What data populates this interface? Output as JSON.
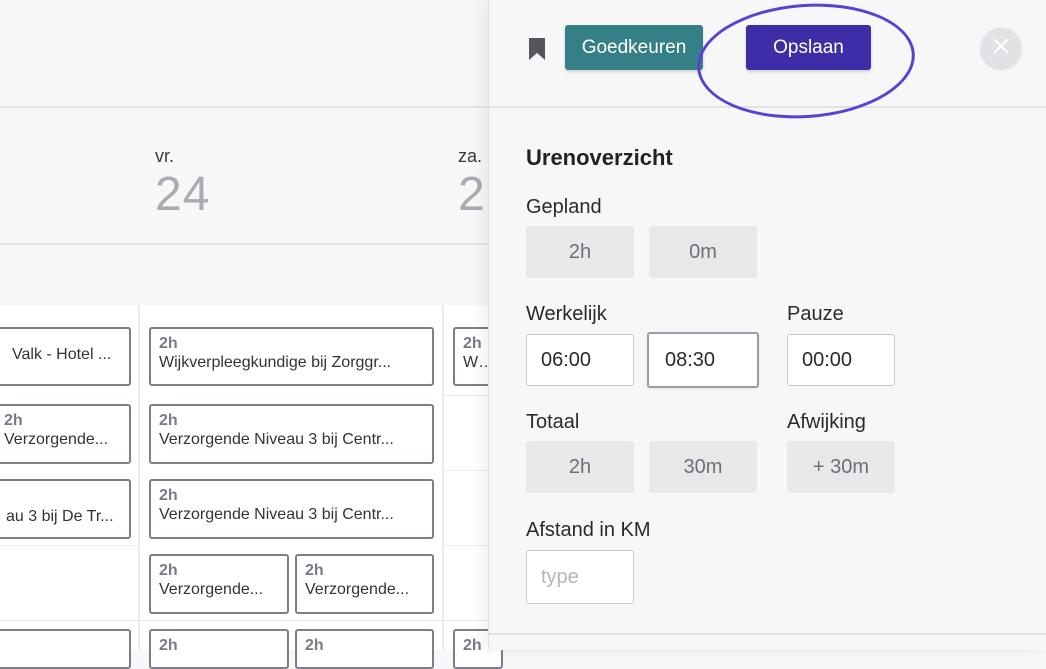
{
  "calendar": {
    "days": [
      {
        "name": "vr.",
        "number": "24"
      },
      {
        "name": "za.",
        "number": "2"
      }
    ],
    "shifts": [
      {
        "duration": "",
        "title": "Valk - Hotel ..."
      },
      {
        "duration": "2h",
        "title": "Wijkverpleegkundige bij Zorggr..."
      },
      {
        "duration": "2h",
        "title": "Wijk"
      },
      {
        "duration": "2h",
        "title": "Verzorgende..."
      },
      {
        "duration": "2h",
        "title": "Verzorgende Niveau 3 bij Centr..."
      },
      {
        "duration": "",
        "title": "au 3 bij De Tr..."
      },
      {
        "duration": "2h",
        "title": "Verzorgende Niveau 3 bij Centr..."
      },
      {
        "duration": "2h",
        "title": "Verzorgende..."
      },
      {
        "duration": "2h",
        "title": "Verzorgende..."
      },
      {
        "duration": "2h",
        "title": ""
      },
      {
        "duration": "2h",
        "title": ""
      },
      {
        "duration": "2h",
        "title": ""
      }
    ]
  },
  "panel": {
    "approve_label": "Goedkeuren",
    "save_label": "Opslaan",
    "section_title": "Urenoverzicht",
    "planned": {
      "label": "Gepland",
      "hours": "2h",
      "minutes": "0m"
    },
    "actual": {
      "label": "Werkelijk",
      "start": "06:00",
      "end": "08:30"
    },
    "pause": {
      "label": "Pauze",
      "value": "00:00"
    },
    "total": {
      "label": "Totaal",
      "hours": "2h",
      "minutes": "30m"
    },
    "deviation": {
      "label": "Afwijking",
      "value": "+ 30m"
    },
    "distance": {
      "label": "Afstand in KM",
      "placeholder": "type"
    }
  },
  "colors": {
    "approve": "#357f86",
    "save": "#3b2ea6",
    "annotation_ring": "#5b3fd6"
  },
  "icons": {
    "bookmark": "bookmark-icon",
    "close": "close-icon"
  }
}
